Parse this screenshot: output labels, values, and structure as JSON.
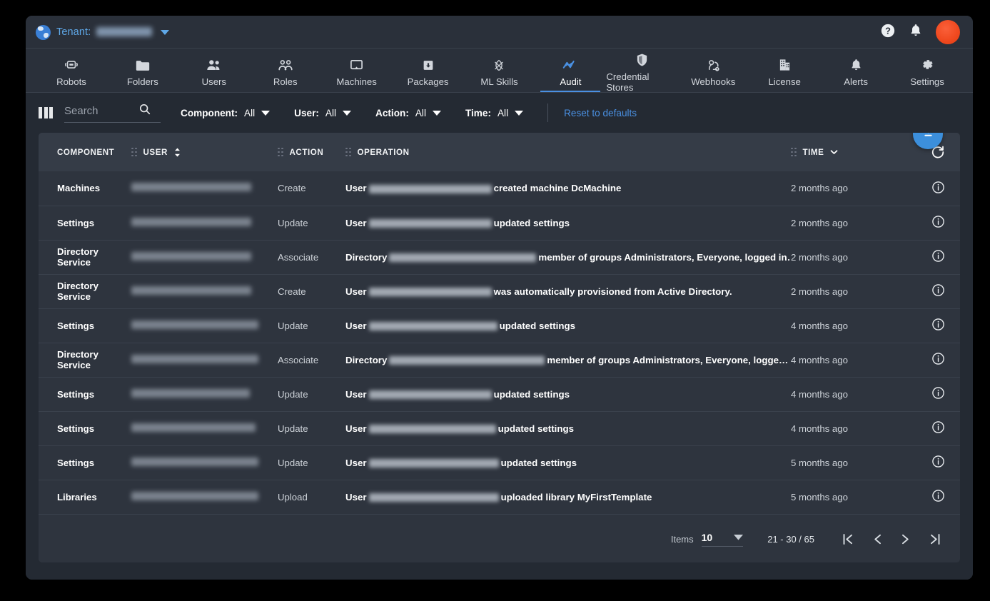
{
  "topbar": {
    "tenant_label": "Tenant:",
    "tenant_value_redacted": "",
    "globe_icon": "globe-icon",
    "help_icon": "help-icon",
    "bell_icon": "bell-icon",
    "avatar_color": "#f04a20"
  },
  "nav": {
    "active": "Audit",
    "accent_color": "#4a90e2",
    "items": [
      {
        "label": "Robots",
        "icon": "robot-icon"
      },
      {
        "label": "Folders",
        "icon": "folder-icon"
      },
      {
        "label": "Users",
        "icon": "users-icon"
      },
      {
        "label": "Roles",
        "icon": "roles-icon"
      },
      {
        "label": "Machines",
        "icon": "monitor-icon"
      },
      {
        "label": "Packages",
        "icon": "package-icon"
      },
      {
        "label": "ML Skills",
        "icon": "ml-skills-icon"
      },
      {
        "label": "Audit",
        "icon": "audit-chart-icon"
      },
      {
        "label": "Credential Stores",
        "icon": "shield-icon"
      },
      {
        "label": "Webhooks",
        "icon": "webhook-icon"
      },
      {
        "label": "License",
        "icon": "building-icon"
      },
      {
        "label": "Alerts",
        "icon": "bell-icon"
      },
      {
        "label": "Settings",
        "icon": "gear-icon"
      }
    ]
  },
  "filters": {
    "columns_icon": "columns-icon",
    "search_placeholder": "Search",
    "search_value": "",
    "search_icon": "search-icon",
    "chips": [
      {
        "key": "Component:",
        "value": "All"
      },
      {
        "key": "User:",
        "value": "All"
      },
      {
        "key": "Action:",
        "value": "All"
      },
      {
        "key": "Time:",
        "value": "All"
      }
    ],
    "reset_label": "Reset to defaults"
  },
  "table": {
    "download_icon": "download-icon",
    "refresh_icon": "refresh-icon",
    "columns": [
      {
        "label": "COMPONENT",
        "sortable": false,
        "draggable": false
      },
      {
        "label": "USER",
        "sortable": true,
        "draggable": true
      },
      {
        "label": "ACTION",
        "sortable": false,
        "draggable": true
      },
      {
        "label": "OPERATION",
        "sortable": false,
        "draggable": true
      },
      {
        "label": "TIME",
        "sortable": true,
        "draggable": true
      }
    ],
    "rows": [
      {
        "component": "Machines",
        "user": "",
        "action": "Create",
        "op_prefix": "User",
        "op_suffix": "created machine DcMachine",
        "time": "2 months ago",
        "user_w": 168,
        "op_w": 172
      },
      {
        "component": "Settings",
        "user": "",
        "action": "Update",
        "op_prefix": "User",
        "op_suffix": "updated settings",
        "time": "2 months ago",
        "user_w": 168,
        "op_w": 172
      },
      {
        "component": "Directory Service",
        "user": "",
        "action": "Associate",
        "op_prefix": "Directory",
        "op_suffix": "member of groups Administrators, Everyone, logged in…",
        "time": "2 months ago",
        "user_w": 168,
        "op_w": 206
      },
      {
        "component": "Directory Service",
        "user": "",
        "action": "Create",
        "op_prefix": "User",
        "op_suffix": "was automatically provisioned from Active Directory.",
        "time": "2 months ago",
        "user_w": 168,
        "op_w": 172
      },
      {
        "component": "Settings",
        "user": "",
        "action": "Update",
        "op_prefix": "User",
        "op_suffix": "updated settings",
        "time": "4 months ago",
        "user_w": 178,
        "op_w": 180
      },
      {
        "component": "Directory Service",
        "user": "",
        "action": "Associate",
        "op_prefix": "Directory",
        "op_suffix": "member of groups Administrators, Everyone, logge…",
        "time": "4 months ago",
        "user_w": 178,
        "op_w": 218
      },
      {
        "component": "Settings",
        "user": "",
        "action": "Update",
        "op_prefix": "User",
        "op_suffix": "updated settings",
        "time": "4 months ago",
        "user_w": 166,
        "op_w": 172
      },
      {
        "component": "Settings",
        "user": "",
        "action": "Update",
        "op_prefix": "User",
        "op_suffix": "updated settings",
        "time": "4 months ago",
        "user_w": 174,
        "op_w": 178
      },
      {
        "component": "Settings",
        "user": "",
        "action": "Update",
        "op_prefix": "User",
        "op_suffix": "updated settings",
        "time": "5 months ago",
        "user_w": 178,
        "op_w": 182
      },
      {
        "component": "Libraries",
        "user": "",
        "action": "Upload",
        "op_prefix": "User",
        "op_suffix": "uploaded library MyFirstTemplate",
        "time": "5 months ago",
        "user_w": 178,
        "op_w": 182
      }
    ]
  },
  "pagination": {
    "items_label": "Items",
    "items_per_page": "10",
    "range": "21 - 30 / 65",
    "first_icon": "first-page-icon",
    "prev_icon": "prev-page-icon",
    "next_icon": "next-page-icon",
    "last_icon": "last-page-icon"
  }
}
